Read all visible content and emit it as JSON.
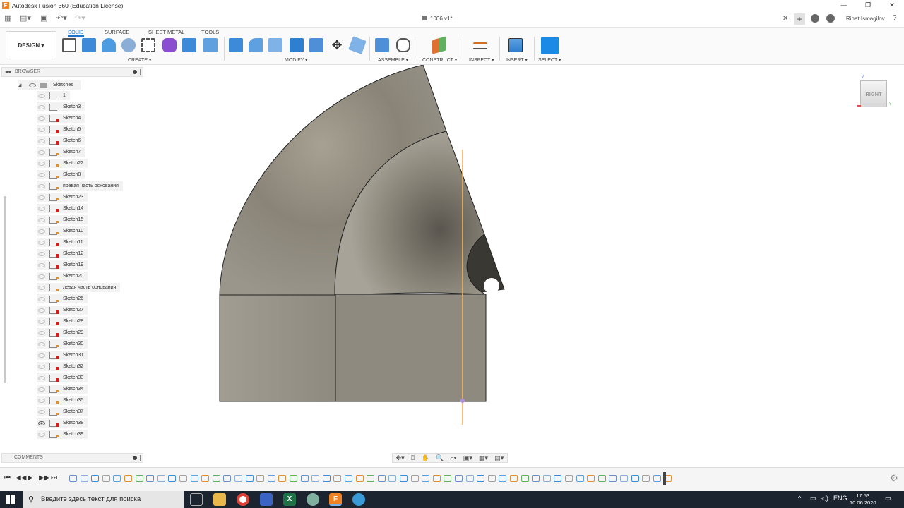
{
  "window": {
    "title": "Autodesk Fusion 360 (Education License)",
    "logo": "F",
    "controls": [
      "—",
      "❐",
      "✕"
    ]
  },
  "tabbar": {
    "document_title": "1006 v1*",
    "close": "✕",
    "add": "+",
    "user": "Rinat Ismagilov",
    "help": "?"
  },
  "ribbon": {
    "workspace": "DESIGN ▾",
    "tabs": [
      "SOLID",
      "SURFACE",
      "SHEET METAL",
      "TOOLS"
    ],
    "active_tab": "SOLID",
    "groups": [
      "CREATE ▾",
      "MODIFY ▾",
      "ASSEMBLE ▾",
      "CONSTRUCT ▾",
      "INSPECT ▾",
      "INSERT ▾",
      "SELECT ▾"
    ]
  },
  "browser": {
    "title": "BROWSER",
    "folder": "Sketches",
    "items": [
      {
        "name": "1",
        "badge": "none",
        "visible": false
      },
      {
        "name": "Sketch3",
        "badge": "none",
        "visible": false
      },
      {
        "name": "Sketch4",
        "badge": "red",
        "visible": false
      },
      {
        "name": "Sketch5",
        "badge": "red",
        "visible": false
      },
      {
        "name": "Sketch6",
        "badge": "red",
        "visible": false
      },
      {
        "name": "Sketch7",
        "badge": "orange",
        "visible": false
      },
      {
        "name": "Sketch22",
        "badge": "orange",
        "visible": false
      },
      {
        "name": "Sketch8",
        "badge": "orange",
        "visible": false
      },
      {
        "name": "правая часть основания",
        "badge": "orange",
        "visible": false
      },
      {
        "name": "Sketch23",
        "badge": "orange",
        "visible": false
      },
      {
        "name": "Sketch14",
        "badge": "red",
        "visible": false
      },
      {
        "name": "Sketch15",
        "badge": "orange",
        "visible": false
      },
      {
        "name": "Sketch10",
        "badge": "orange",
        "visible": false
      },
      {
        "name": "Sketch11",
        "badge": "red",
        "visible": false
      },
      {
        "name": "Sketch12",
        "badge": "red",
        "visible": false
      },
      {
        "name": "Sketch19",
        "badge": "red",
        "visible": false
      },
      {
        "name": "Sketch20",
        "badge": "orange",
        "visible": false
      },
      {
        "name": "левая часть основания",
        "badge": "orange",
        "visible": false
      },
      {
        "name": "Sketch26",
        "badge": "orange",
        "visible": false
      },
      {
        "name": "Sketch27",
        "badge": "red",
        "visible": false
      },
      {
        "name": "Sketch28",
        "badge": "red",
        "visible": false
      },
      {
        "name": "Sketch29",
        "badge": "red",
        "visible": false
      },
      {
        "name": "Sketch30",
        "badge": "orange",
        "visible": false
      },
      {
        "name": "Sketch31",
        "badge": "red",
        "visible": false
      },
      {
        "name": "Sketch32",
        "badge": "red",
        "visible": false
      },
      {
        "name": "Sketch33",
        "badge": "red",
        "visible": false
      },
      {
        "name": "Sketch34",
        "badge": "orange",
        "visible": false
      },
      {
        "name": "Sketch35",
        "badge": "orange",
        "visible": false
      },
      {
        "name": "Sketch37",
        "badge": "orange",
        "visible": false
      },
      {
        "name": "Sketch38",
        "badge": "red",
        "visible": true
      },
      {
        "name": "Sketch39",
        "badge": "orange",
        "visible": false
      }
    ]
  },
  "comments": {
    "title": "COMMENTS"
  },
  "viewcube": {
    "face": "RIGHT",
    "z": "Z",
    "y": "Y"
  },
  "taskbar": {
    "search_placeholder": "Введите здесь текст для поиска",
    "language": "ENG",
    "time": "17:53",
    "date": "10.06.2020"
  },
  "colors": {
    "accent": "#1a73c6",
    "badge_red": "#d02020",
    "badge_orange": "#e09030",
    "taskbar": "#1c2430"
  }
}
